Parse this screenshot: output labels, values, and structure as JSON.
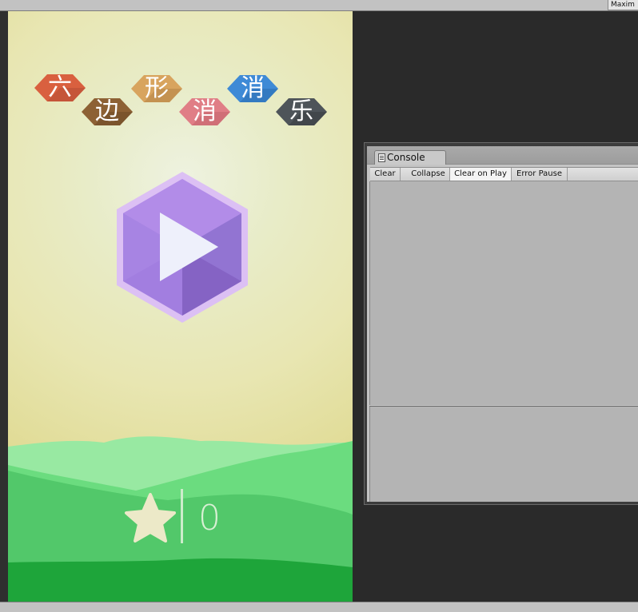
{
  "editor": {
    "maximize_label": "Maxim"
  },
  "game": {
    "title_characters": [
      "六",
      "边",
      "形",
      "消",
      "消",
      "乐"
    ],
    "title_colors": [
      "#d9603f",
      "#8d6134",
      "#d8a45e",
      "#e07e86",
      "#3e8ad6",
      "#4e5459"
    ],
    "play_button_icon": "play-icon",
    "score_icon": "star-icon",
    "score": "0",
    "colors": {
      "play_hex_outer": "#dcc0f4",
      "play_hex_main": "#a27ee0",
      "star": "#ece9c8",
      "grass_light": "#63d776",
      "grass_dark": "#1ea53a"
    }
  },
  "console": {
    "tab_label": "Console",
    "toolbar": {
      "clear": "Clear",
      "collapse": "Collapse",
      "clear_on_play": "Clear on Play",
      "error_pause": "Error Pause"
    }
  }
}
